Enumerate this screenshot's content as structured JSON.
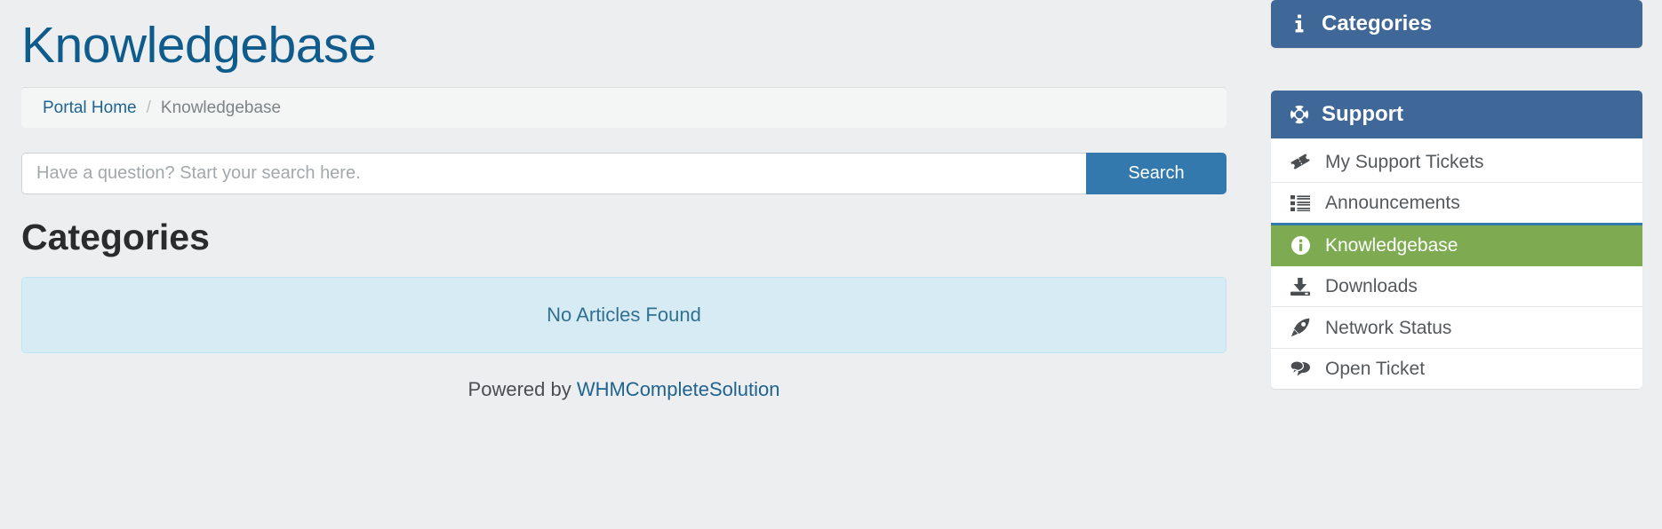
{
  "page": {
    "title": "Knowledgebase"
  },
  "breadcrumb": {
    "home_label": "Portal Home",
    "separator": "/",
    "current_label": "Knowledgebase"
  },
  "search": {
    "placeholder": "Have a question? Start your search here.",
    "value": "",
    "button_label": "Search"
  },
  "content": {
    "section_title": "Categories",
    "empty_message": "No Articles Found"
  },
  "footer": {
    "prefix": "Powered by ",
    "link_label": "WHMCompleteSolution"
  },
  "sidebar": {
    "panels": [
      {
        "title": "Categories",
        "icon": "info-icon",
        "items": []
      },
      {
        "title": "Support",
        "icon": "lifebuoy-icon",
        "items": [
          {
            "label": "My Support Tickets",
            "icon": "ticket-icon",
            "active": false
          },
          {
            "label": "Announcements",
            "icon": "list-icon",
            "active": false
          },
          {
            "label": "Knowledgebase",
            "icon": "info-circle-icon",
            "active": true
          },
          {
            "label": "Downloads",
            "icon": "download-icon",
            "active": false
          },
          {
            "label": "Network Status",
            "icon": "rocket-icon",
            "active": false
          },
          {
            "label": "Open Ticket",
            "icon": "comments-icon",
            "active": false
          }
        ]
      }
    ]
  },
  "colors": {
    "page_background": "#eceeef",
    "title_blue": "#0f5c8c",
    "link_blue": "#1f6390",
    "button_blue": "#3479ad",
    "panel_header_blue": "#3f6898",
    "active_green": "#7eab51",
    "alert_background": "#d7ebf5",
    "alert_text": "#31708f"
  }
}
